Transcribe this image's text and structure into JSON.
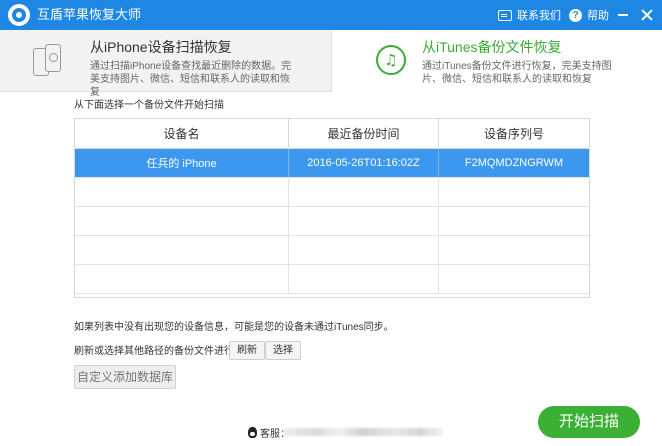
{
  "app": {
    "title": "互盾苹果恢复大师"
  },
  "titlebar": {
    "contact_label": "联系我们",
    "help_label": "帮助",
    "help_glyph": "?"
  },
  "modes": [
    {
      "title": "从iPhone设备扫描恢复",
      "description": "通过扫描iPhone设备查找最近删除的数据。完美支持图片、微信、短信和联系人的读取和恢复"
    },
    {
      "title": "从iTunes备份文件恢复",
      "description": "通过iTunes备份文件进行恢复，完美支持图片、微信、短信和联系人的读取和恢复"
    }
  ],
  "music_glyph": "♫",
  "instruction": "从下面选择一个备份文件开始扫描",
  "table": {
    "headers": [
      "设备名",
      "最近备份时间",
      "设备序列号"
    ],
    "rows": [
      {
        "name": "任兵的 iPhone",
        "backup_time": "2016-05-26T01:16:02Z",
        "serial": "F2MQMDZNGRWM"
      }
    ]
  },
  "notes": {
    "not_listed": "如果列表中没有出现您的设备信息，可能是您的设备未通过iTunes同步。",
    "refresh_hint": "刷新或选择其他路径的备份文件进行恢复。"
  },
  "buttons": {
    "refresh": "刷新",
    "select": "选择",
    "custom_db": "自定义添加数据库",
    "start_scan": "开始扫描"
  },
  "footer": {
    "service_label": "客服："
  },
  "colors": {
    "titlebar": "#1e87e3",
    "selected_row": "#3c97ee",
    "accent_green": "#3cb035"
  }
}
